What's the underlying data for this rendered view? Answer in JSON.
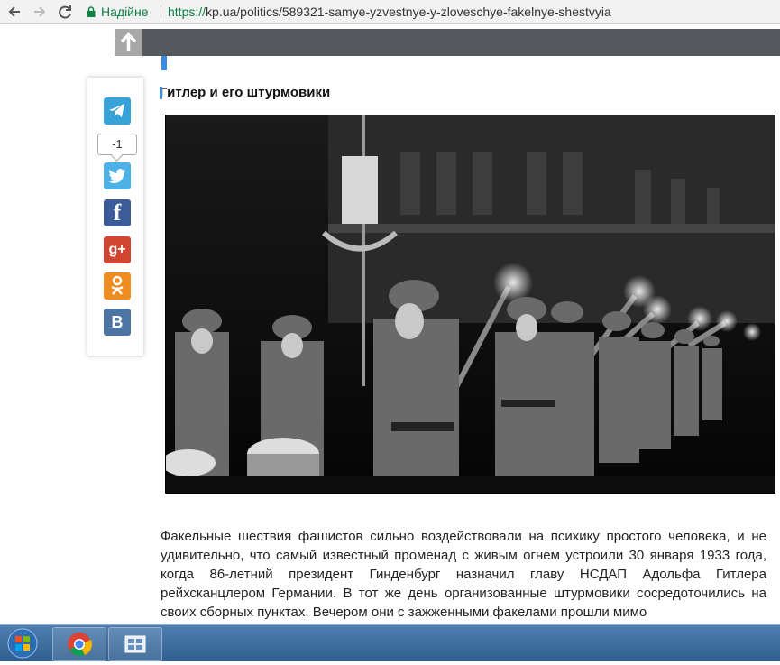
{
  "browser": {
    "secure_label": "Надійне",
    "url_scheme": "https://",
    "url_rest": "kp.ua/politics/589321-samye-yzvestnye-y-zloveschye-fakelnye-shestvyia"
  },
  "share": {
    "twitter_count": "-1",
    "telegram_icon": "telegram-icon",
    "twitter_icon": "twitter-icon",
    "facebook_label": "f",
    "googleplus_label": "g+",
    "vk_label": "B"
  },
  "article": {
    "heading": "Гитлер и его штурмовики",
    "body": "Факельные шествия фашистов сильно воздействовали на психику простого человека, и не удивительно, что самый известный променад с живым огнем устроили 30 января 1933 года, когда 86-летний президент Гинденбург назначил главу НСДАП Адольфа Гитлера рейхсканцлером Германии. В тот же день организованные штурмовики сосредоточились на своих сборных пунктах. Вечером они с зажженными факелами прошли мимо"
  },
  "colors": {
    "header": "#54575c",
    "accent": "#3c8be0",
    "secure_green": "#0b8043"
  }
}
